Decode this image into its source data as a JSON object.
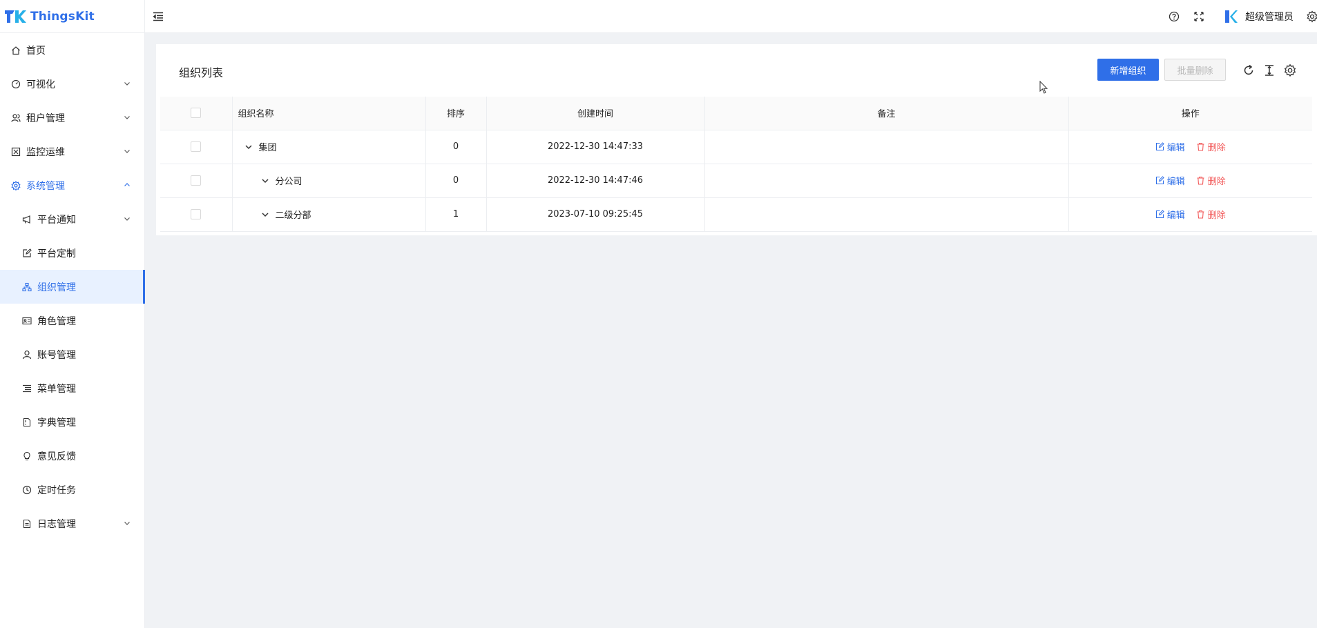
{
  "app": {
    "name": "ThingsKit"
  },
  "colors": {
    "accent": "#2f6fe8",
    "danger": "#f25a5a"
  },
  "sidebar": {
    "items": [
      {
        "label": "首页",
        "icon": "home-icon"
      },
      {
        "label": "可视化",
        "icon": "dashboard-icon"
      },
      {
        "label": "租户管理",
        "icon": "users-icon"
      },
      {
        "label": "监控运维",
        "icon": "monitor-icon"
      },
      {
        "label": "系统管理",
        "icon": "gear-icon"
      },
      {
        "label": "平台通知",
        "icon": "megaphone-icon"
      },
      {
        "label": "平台定制",
        "icon": "edit-icon"
      },
      {
        "label": "组织管理",
        "icon": "org-chart-icon"
      },
      {
        "label": "角色管理",
        "icon": "id-card-icon"
      },
      {
        "label": "账号管理",
        "icon": "user-icon"
      },
      {
        "label": "菜单管理",
        "icon": "menu-list-icon"
      },
      {
        "label": "字典管理",
        "icon": "book-icon"
      },
      {
        "label": "意见反馈",
        "icon": "bulb-icon"
      },
      {
        "label": "定时任务",
        "icon": "clock-icon"
      },
      {
        "label": "日志管理",
        "icon": "file-icon"
      }
    ]
  },
  "header": {
    "user_name": "超级管理员"
  },
  "card": {
    "title": "组织列表",
    "add_button": "新增组织",
    "batch_delete_button": "批量删除"
  },
  "table": {
    "columns": [
      "组织名称",
      "排序",
      "创建时间",
      "备注",
      "操作"
    ],
    "rows": [
      {
        "name": "集团",
        "sort": "0",
        "created": "2022-12-30 14:47:33",
        "remark": ""
      },
      {
        "name": "分公司",
        "sort": "0",
        "created": "2022-12-30 14:47:46",
        "remark": ""
      },
      {
        "name": "二级分部",
        "sort": "1",
        "created": "2023-07-10 09:25:45",
        "remark": ""
      }
    ],
    "edit_label": "编辑",
    "delete_label": "删除"
  }
}
